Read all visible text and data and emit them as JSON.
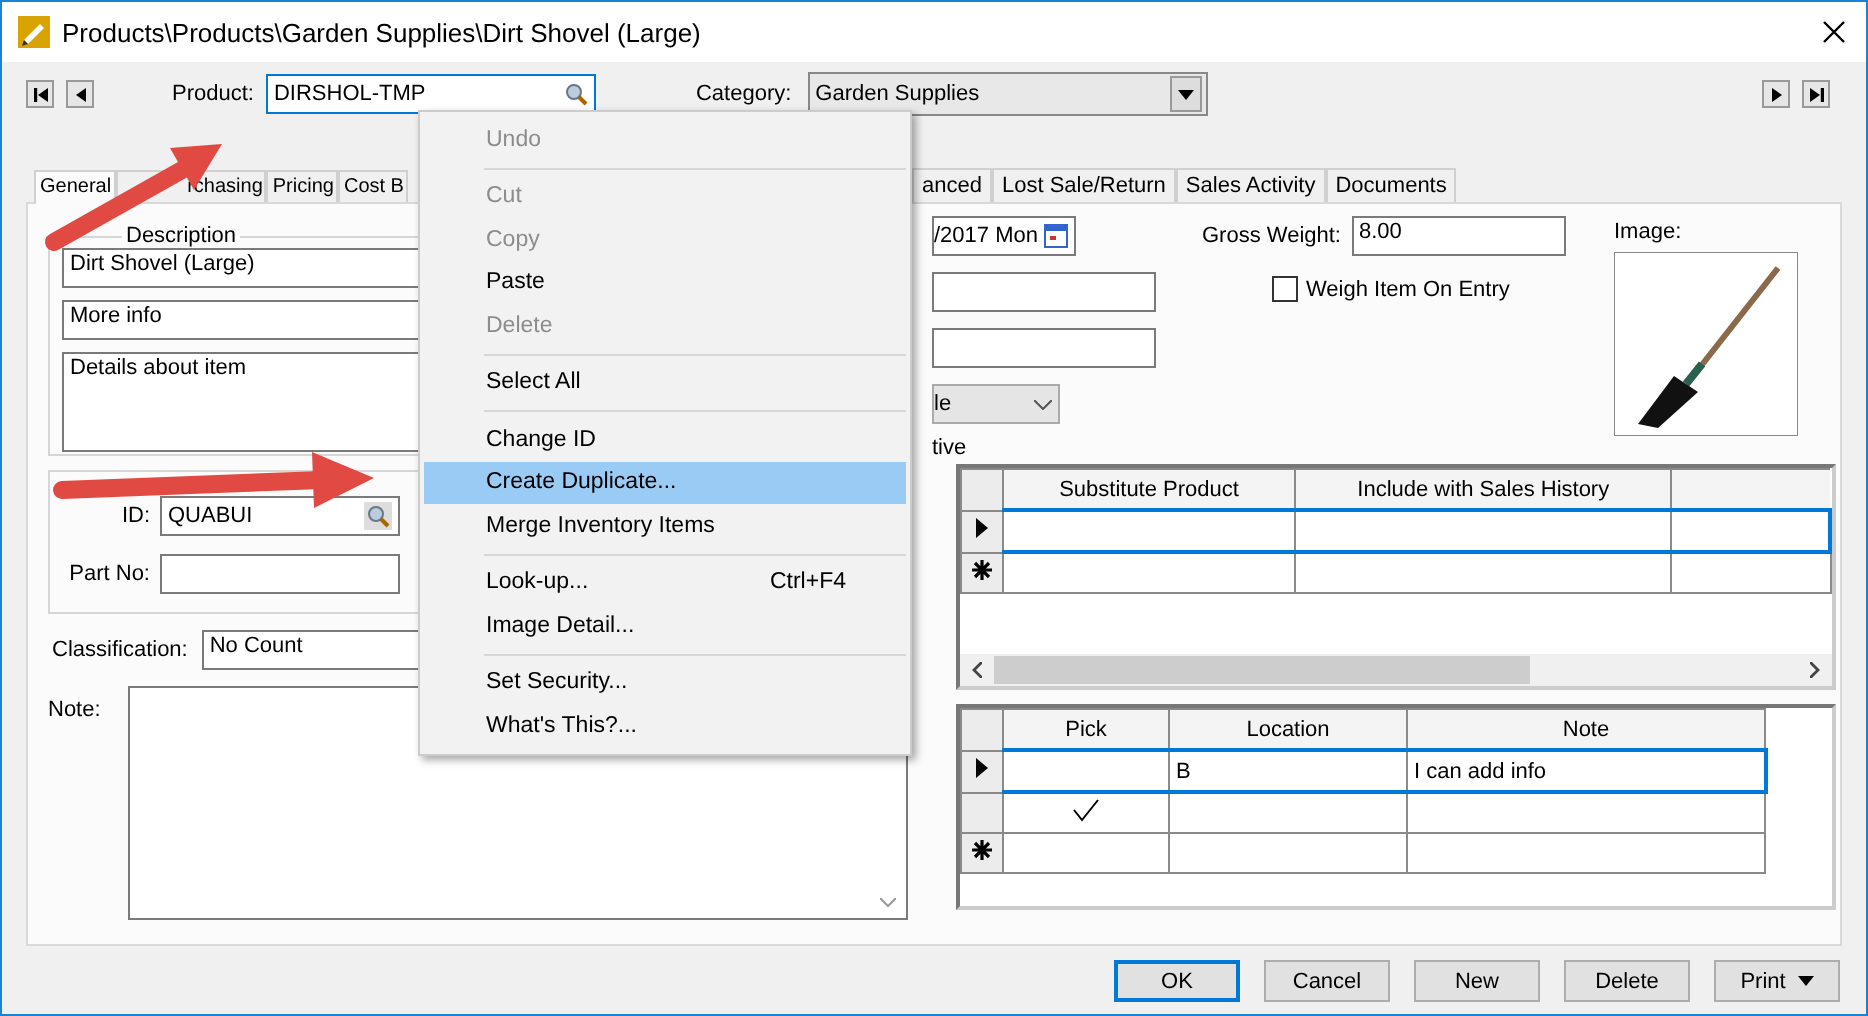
{
  "window": {
    "title": "Products\\Products\\Garden Supplies\\Dirt Shovel (Large)"
  },
  "header": {
    "product_label": "Product:",
    "product_value": "DIRSHOL-TMP",
    "category_label": "Category:",
    "category_value": "Garden Supplies"
  },
  "tabs_left": [
    {
      "label": "General",
      "selected": true
    },
    {
      "label": "rchasing",
      "selected": false
    },
    {
      "label": "Pricing",
      "selected": false
    },
    {
      "label": "Cost B",
      "selected": false
    }
  ],
  "tabs_right": [
    {
      "label": "anced",
      "selected": false
    },
    {
      "label": "Lost Sale/Return",
      "selected": false
    },
    {
      "label": "Sales Activity",
      "selected": false
    },
    {
      "label": "Documents",
      "selected": false
    }
  ],
  "general": {
    "description_label": "Description",
    "description": "Dirt Shovel (Large)",
    "more_info": "More info",
    "details": "Details about item",
    "id_label": "ID:",
    "id_value": "QUABUI",
    "part_no_label": "Part No:",
    "classification_label": "Classification:",
    "classification": "No Count",
    "note_label": "Note:"
  },
  "right": {
    "date": "/2017 Mon",
    "dropdown": "le",
    "caption": "tive",
    "gross_weight_label": "Gross Weight:",
    "gross_weight": "8.00",
    "weigh_on_entry": {
      "label": "Weigh Item On Entry",
      "checked": false
    },
    "image_label": "Image:"
  },
  "substitutes": {
    "columns": [
      "Substitute Product",
      "Include with Sales History"
    ],
    "rows": [
      {
        "kind": "current"
      },
      {
        "kind": "new"
      }
    ]
  },
  "locations": {
    "columns": [
      "Pick",
      "Location",
      "Note"
    ],
    "rows": [
      {
        "kind": "current",
        "pick": false,
        "location": "B",
        "note": "I can add info"
      },
      {
        "kind": "plain",
        "pick": true
      },
      {
        "kind": "new",
        "pick": false
      }
    ]
  },
  "buttons": [
    {
      "label": "OK",
      "default": true,
      "dropdown": false
    },
    {
      "label": "Cancel",
      "default": false,
      "dropdown": false
    },
    {
      "label": "New",
      "default": false,
      "dropdown": false
    },
    {
      "label": "Delete",
      "default": false,
      "dropdown": false
    },
    {
      "label": "Print",
      "default": false,
      "dropdown": true
    }
  ],
  "context_menu": [
    {
      "kind": "item",
      "label": "Undo",
      "disabled": true,
      "selected": false
    },
    {
      "kind": "separator"
    },
    {
      "kind": "item",
      "label": "Cut",
      "disabled": true,
      "selected": false
    },
    {
      "kind": "item",
      "label": "Copy",
      "disabled": true,
      "selected": false
    },
    {
      "kind": "item",
      "label": "Paste",
      "disabled": false,
      "selected": false
    },
    {
      "kind": "item",
      "label": "Delete",
      "disabled": true,
      "selected": false
    },
    {
      "kind": "separator"
    },
    {
      "kind": "item",
      "label": "Select All",
      "disabled": false,
      "selected": false
    },
    {
      "kind": "separator"
    },
    {
      "kind": "item",
      "label": "Change ID",
      "disabled": false,
      "selected": false
    },
    {
      "kind": "item",
      "label": "Create Duplicate...",
      "disabled": false,
      "selected": true
    },
    {
      "kind": "item",
      "label": "Merge Inventory Items",
      "disabled": false,
      "selected": false
    },
    {
      "kind": "separator"
    },
    {
      "kind": "item",
      "label": "Look-up...",
      "shortcut": "Ctrl+F4",
      "disabled": false,
      "selected": false
    },
    {
      "kind": "item",
      "label": "Image Detail...",
      "disabled": false,
      "selected": false
    },
    {
      "kind": "separator"
    },
    {
      "kind": "item",
      "label": "Set Security...",
      "disabled": false,
      "selected": false
    },
    {
      "kind": "item",
      "label": "What's This?...",
      "disabled": false,
      "selected": false
    }
  ]
}
